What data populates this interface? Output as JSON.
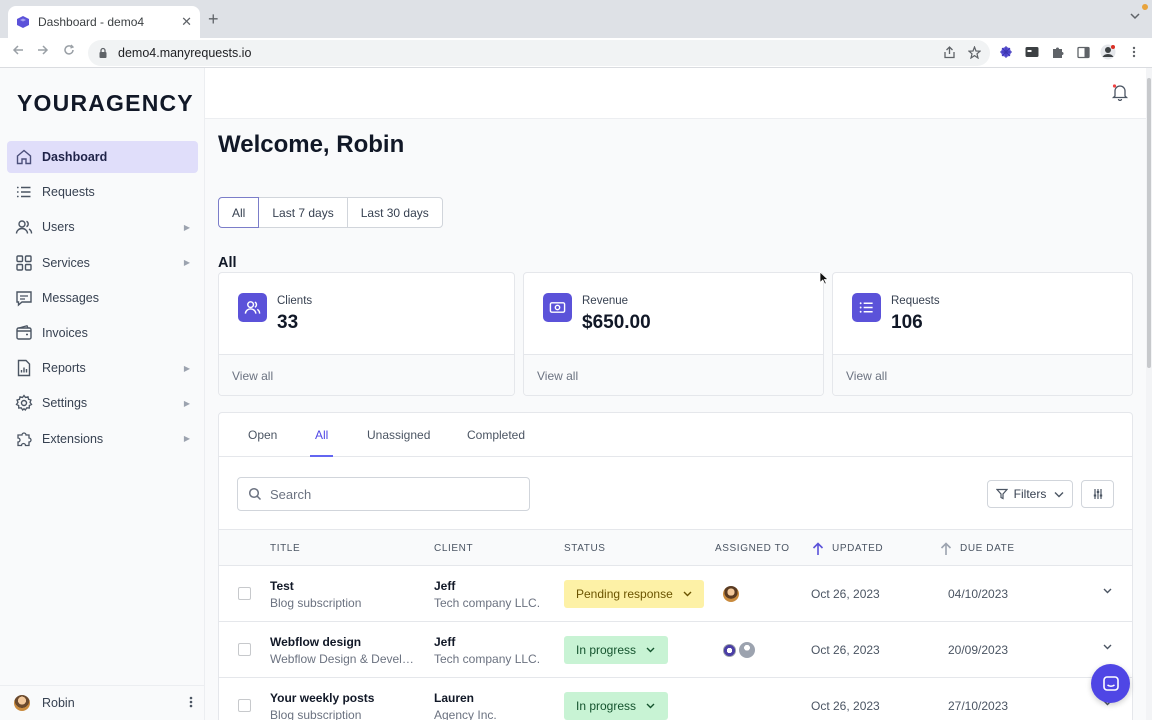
{
  "browser": {
    "tab_title": "Dashboard - demo4",
    "tab_close": "✕",
    "new_tab": "+",
    "url": "demo4.manyrequests.io"
  },
  "sidebar": {
    "logo": "YOURAGENCY",
    "items": [
      {
        "label": "Dashboard",
        "icon": "home-icon",
        "active": true
      },
      {
        "label": "Requests",
        "icon": "list-icon"
      },
      {
        "label": "Users",
        "icon": "users-icon",
        "caret": "▶"
      },
      {
        "label": "Services",
        "icon": "grid-icon",
        "caret": "▶"
      },
      {
        "label": "Messages",
        "icon": "chat-icon"
      },
      {
        "label": "Invoices",
        "icon": "wallet-icon"
      },
      {
        "label": "Reports",
        "icon": "report-icon",
        "caret": "▶"
      },
      {
        "label": "Settings",
        "icon": "gear-icon",
        "caret": "▶"
      },
      {
        "label": "Extensions",
        "icon": "puzzle-icon",
        "caret": "▶"
      }
    ],
    "user_name": "Robin"
  },
  "main": {
    "welcome": "Welcome, Robin",
    "ranges": [
      "All",
      "Last 7 days",
      "Last 30 days"
    ],
    "section_title": "All",
    "cards": [
      {
        "label": "Clients",
        "value": "33",
        "link": "View all",
        "icon": "users-icon"
      },
      {
        "label": "Revenue",
        "value": "$650.00",
        "link": "View all",
        "icon": "cash-icon"
      },
      {
        "label": "Requests",
        "value": "106",
        "link": "View all",
        "icon": "list-icon"
      }
    ],
    "tabs": [
      "Open",
      "All",
      "Unassigned",
      "Completed"
    ],
    "search_placeholder": "Search",
    "filters_label": "Filters",
    "columns": {
      "title": "TITLE",
      "client": "CLIENT",
      "status": "STATUS",
      "assigned": "ASSIGNED TO",
      "updated": "UPDATED",
      "due": "DUE DATE"
    },
    "rows": [
      {
        "title": "Test",
        "subtitle": "Blog subscription",
        "client": "Jeff",
        "company": "Tech company LLC.",
        "status": "Pending response",
        "updated": "Oct 26, 2023",
        "due": "04/10/2023"
      },
      {
        "title": "Webflow design",
        "subtitle": "Webflow Design & Development",
        "client": "Jeff",
        "company": "Tech company LLC.",
        "status": "In progress",
        "updated": "Oct 26, 2023",
        "due": "20/09/2023"
      },
      {
        "title": "Your weekly posts",
        "subtitle": "Blog subscription",
        "client": "Lauren",
        "company": "Agency Inc.",
        "status": "In progress",
        "updated": "Oct 26, 2023",
        "due": "27/10/2023"
      }
    ]
  },
  "colors": {
    "accent": "#5b52d9",
    "active_nav": "#e0defa",
    "pending": "#fdf1a6",
    "in_progress": "#c8f3d4"
  }
}
